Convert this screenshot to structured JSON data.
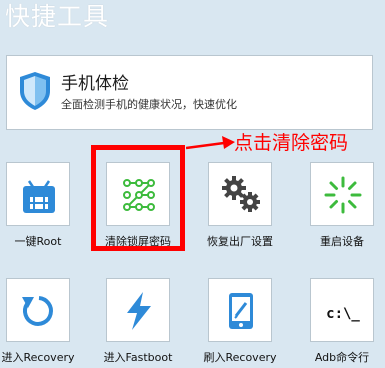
{
  "section": {
    "title": "快捷工具"
  },
  "health": {
    "title": "手机体检",
    "description": "全面检测手机的健康状况，快速优化",
    "icon": "shield-icon"
  },
  "annotation": {
    "text": "点击清除密码",
    "color": "#ff0000"
  },
  "tiles": [
    {
      "label": "一键Root",
      "icon": "android-root-icon"
    },
    {
      "label": "清除锁屏密码",
      "icon": "pattern-lock-icon"
    },
    {
      "label": "恢复出厂设置",
      "icon": "gears-icon"
    },
    {
      "label": "重启设备",
      "icon": "restart-spinner-icon"
    },
    {
      "label": "进入Recovery",
      "icon": "refresh-arrow-icon"
    },
    {
      "label": "进入Fastboot",
      "icon": "lightning-icon"
    },
    {
      "label": "刷入Recovery",
      "icon": "tablet-edit-icon"
    },
    {
      "label": "Adb命令行",
      "icon": "terminal-icon"
    }
  ],
  "colors": {
    "accent": "#2e8ad8",
    "green": "#3dbb3d",
    "background": "#d9e7f1"
  }
}
